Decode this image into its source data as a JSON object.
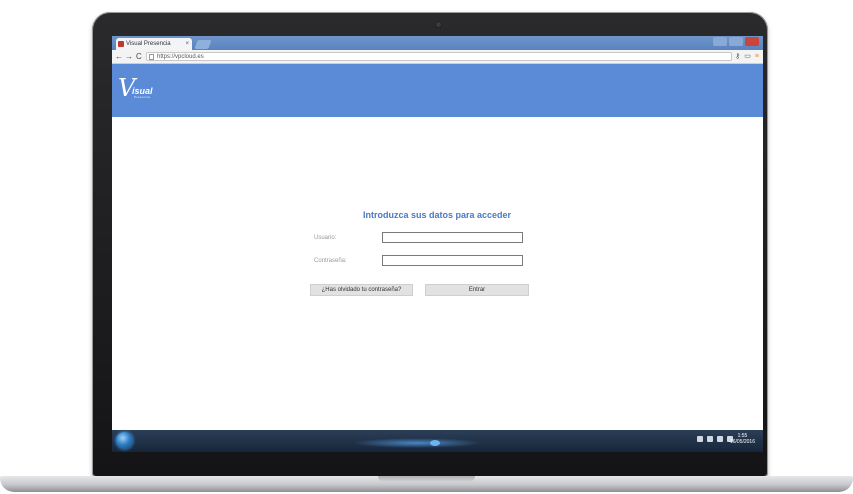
{
  "browser": {
    "tab_title": "Visual Presencia",
    "tab_close": "×",
    "url": "https://vpcloud.es",
    "nav": {
      "back": "←",
      "forward": "→",
      "reload": "C"
    },
    "icons": {
      "key": "key-icon",
      "page": "page-icon",
      "menu": "menu-icon"
    }
  },
  "header": {
    "logo_text": "isual",
    "logo_subtext": "Presencia",
    "brand_color": "#5b8ad6"
  },
  "login": {
    "title": "Introduzca sus datos para acceder",
    "username_label": "Usuario:",
    "password_label": "Contraseña:",
    "forgot_button": "¿Has olvidado tu contraseña?",
    "submit_button": "Entrar"
  },
  "taskbar": {
    "clock_time": "1:55",
    "clock_date": "16/05/2016"
  }
}
